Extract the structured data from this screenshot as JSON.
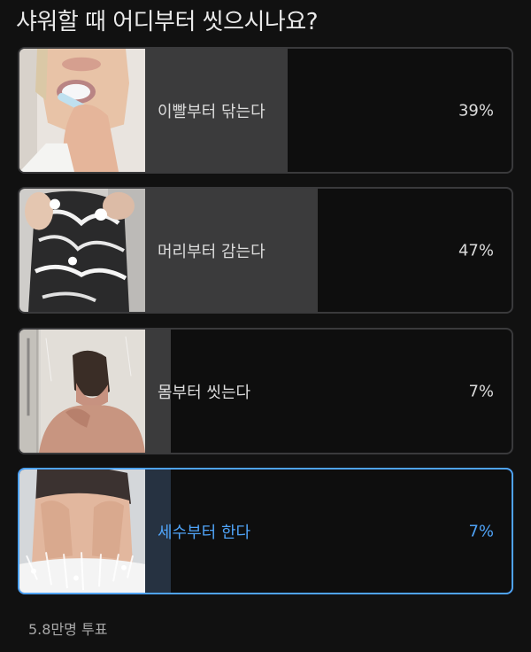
{
  "poll": {
    "question": "샤워할 때 어디부터 씻으시나요?",
    "options": [
      {
        "label": "이빨부터 닦는다",
        "percent_text": "39%",
        "percent": 39,
        "image": "toothbrushing-photo",
        "selected": false
      },
      {
        "label": "머리부터 감는다",
        "percent_text": "47%",
        "percent": 47,
        "image": "hair-washing-photo",
        "selected": false
      },
      {
        "label": "몸부터 씻는다",
        "percent_text": "7%",
        "percent": 7,
        "image": "body-shower-photo",
        "selected": false
      },
      {
        "label": "세수부터 한다",
        "percent_text": "7%",
        "percent": 7,
        "image": "face-washing-photo",
        "selected": true
      }
    ],
    "vote_count": "5.8만명 투표"
  },
  "colors": {
    "background": "#111111",
    "option_border": "#3a3a3c",
    "bar_fill": "#3b3b3c",
    "selected_accent": "#4fa3f7",
    "selected_fill": "#263241"
  }
}
